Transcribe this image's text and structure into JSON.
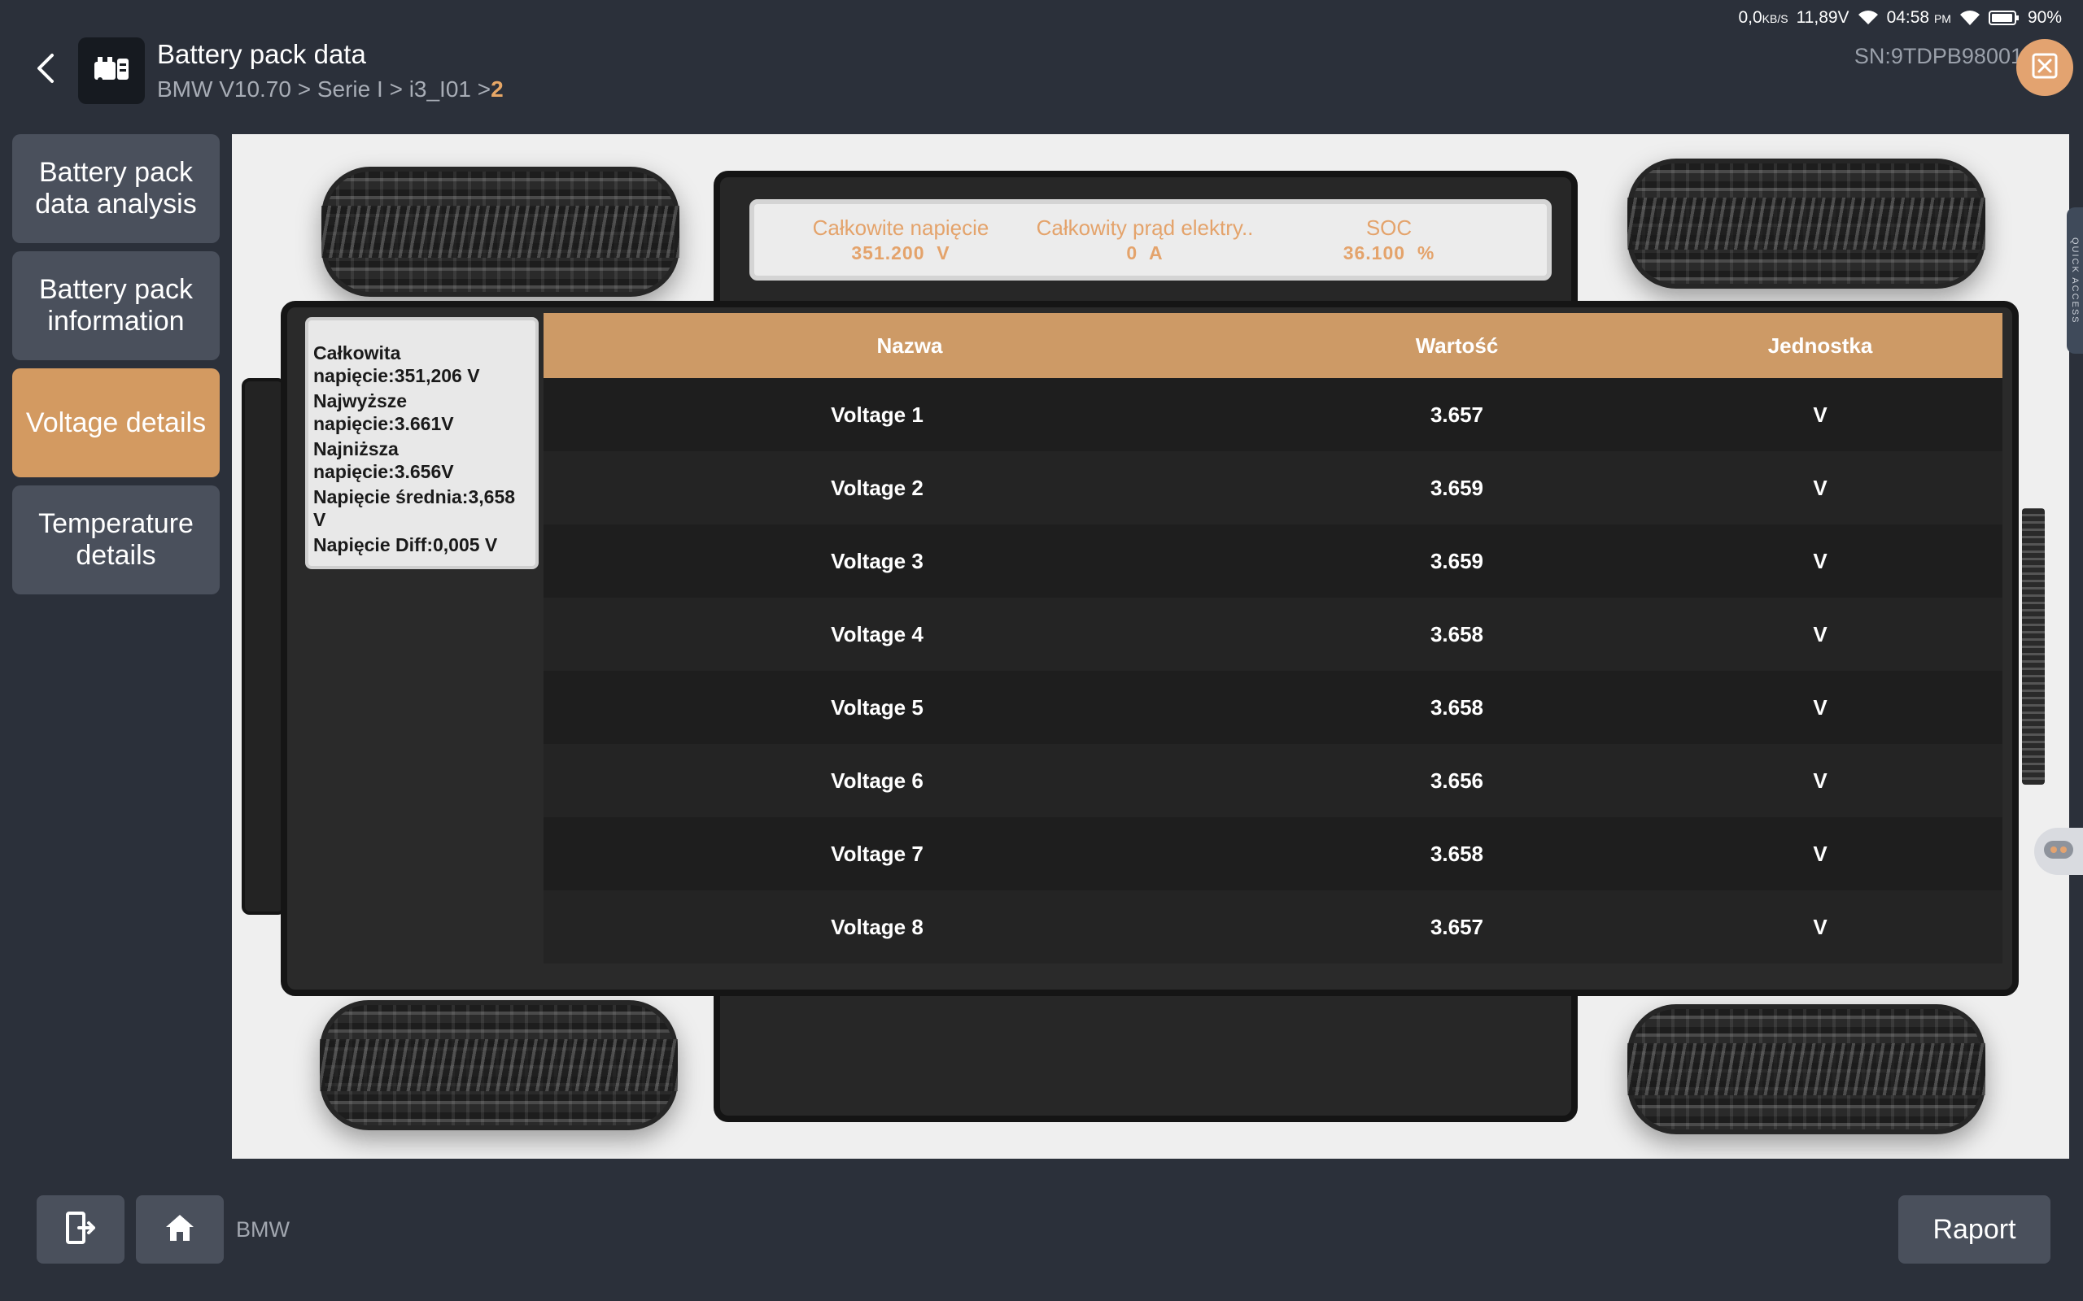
{
  "status_bar": {
    "net_speed": "0,0",
    "net_unit": "KB/S",
    "voltage": "11,89V",
    "time": "04:58",
    "ampm": "PM",
    "battery": "90%"
  },
  "header": {
    "title": "Battery pack data",
    "breadcrumb": {
      "path": "BMW V10.70 > Serie I > i3_I01 > ",
      "current": "2"
    },
    "serial": "SN:9TDPB98001"
  },
  "sidebar": {
    "items": [
      {
        "label": "Battery pack data analysis",
        "active": false
      },
      {
        "label": "Battery pack information",
        "active": false
      },
      {
        "label": "Voltage details",
        "active": true
      },
      {
        "label": "Temperature details",
        "active": false
      }
    ]
  },
  "summary": {
    "items": [
      {
        "label": "Całkowite napięcie",
        "value": "351.200",
        "unit": "V"
      },
      {
        "label": "Całkowity prąd elektry..",
        "value": "0",
        "unit": "A"
      },
      {
        "label": "SOC",
        "value": "36.100",
        "unit": "%"
      }
    ]
  },
  "stats": {
    "lines": [
      "Całkowita napięcie:351,206 V",
      "Najwyższe napięcie:3.661V",
      "Najniższa napięcie:3.656V",
      "Napięcie średnia:3,658 V",
      "Napięcie Diff:0,005 V"
    ]
  },
  "table": {
    "headers": {
      "name": "Nazwa",
      "value": "Wartość",
      "unit": "Jednostka"
    },
    "rows": [
      {
        "name": "Voltage 1",
        "value": "3.657",
        "unit": "V"
      },
      {
        "name": "Voltage 2",
        "value": "3.659",
        "unit": "V"
      },
      {
        "name": "Voltage 3",
        "value": "3.659",
        "unit": "V"
      },
      {
        "name": "Voltage 4",
        "value": "3.658",
        "unit": "V"
      },
      {
        "name": "Voltage 5",
        "value": "3.658",
        "unit": "V"
      },
      {
        "name": "Voltage 6",
        "value": "3.656",
        "unit": "V"
      },
      {
        "name": "Voltage 7",
        "value": "3.658",
        "unit": "V"
      },
      {
        "name": "Voltage 8",
        "value": "3.657",
        "unit": "V"
      }
    ]
  },
  "quick_access": {
    "label": "QUICK ACCESS"
  },
  "footer": {
    "brand": "BMW",
    "report_label": "Raport"
  },
  "icons": {
    "back": "chevron-left-icon",
    "app": "battery-pack-icon",
    "close": "exit-fullscreen-icon",
    "exit": "exit-door-icon",
    "home": "home-icon"
  },
  "colors": {
    "accent": "#d39a61",
    "summary_text": "#e4a36b",
    "background": "#2b303a"
  }
}
